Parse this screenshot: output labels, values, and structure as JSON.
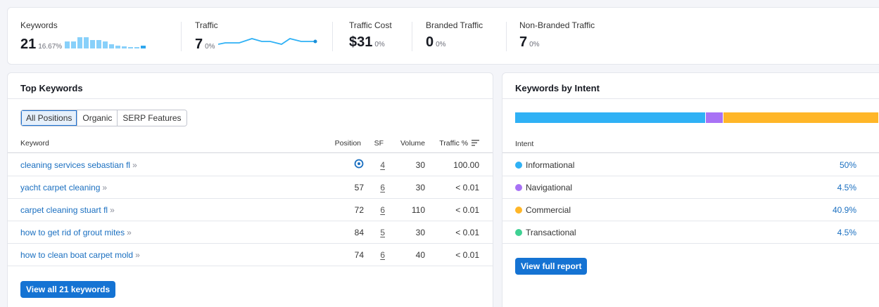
{
  "summary": {
    "keywords": {
      "label": "Keywords",
      "value": "21",
      "pct": "16.67%"
    },
    "traffic": {
      "label": "Traffic",
      "value": "7",
      "pct": "0%"
    },
    "traffic_cost": {
      "label": "Traffic Cost",
      "value": "$31",
      "pct": "0%"
    },
    "branded": {
      "label": "Branded Traffic",
      "value": "0",
      "pct": "0%"
    },
    "non_branded": {
      "label": "Non-Branded Traffic",
      "value": "7",
      "pct": "0%"
    }
  },
  "top_keywords": {
    "title": "Top Keywords",
    "tabs": [
      "All Positions",
      "Organic",
      "SERP Features"
    ],
    "columns": {
      "keyword": "Keyword",
      "position": "Position",
      "sf": "SF",
      "volume": "Volume",
      "traffic": "Traffic %"
    },
    "rows": [
      {
        "keyword": "cleaning services sebastian fl",
        "position": "",
        "position_icon": "location-pin-icon",
        "sf": "4",
        "volume": "30",
        "traffic": "100.00"
      },
      {
        "keyword": "yacht carpet cleaning",
        "position": "57",
        "sf": "6",
        "volume": "30",
        "traffic": "< 0.01"
      },
      {
        "keyword": "carpet cleaning stuart fl",
        "position": "72",
        "sf": "6",
        "volume": "110",
        "traffic": "< 0.01"
      },
      {
        "keyword": "how to get rid of grout mites",
        "position": "84",
        "sf": "5",
        "volume": "30",
        "traffic": "< 0.01"
      },
      {
        "keyword": "how to clean boat carpet mold",
        "position": "74",
        "sf": "6",
        "volume": "40",
        "traffic": "< 0.01"
      }
    ],
    "chevron": "»",
    "view_all": "View all 21 keywords"
  },
  "by_intent": {
    "title": "Keywords by Intent",
    "column": "Intent",
    "rows": [
      {
        "name": "Informational",
        "value": "50%",
        "color": "#2fb1f5"
      },
      {
        "name": "Navigational",
        "value": "4.5%",
        "color": "#a872f5"
      },
      {
        "name": "Commercial",
        "value": "40.9%",
        "color": "#ffb628"
      },
      {
        "name": "Transactional",
        "value": "4.5%",
        "color": "#3fd193"
      }
    ],
    "bar_shares": [
      50,
      4.5,
      40.9,
      4.5
    ],
    "view_full": "View full report"
  },
  "colors": {
    "accent": "#1573d3",
    "link": "#1a6fc0",
    "spark": "#2fb1f5"
  }
}
